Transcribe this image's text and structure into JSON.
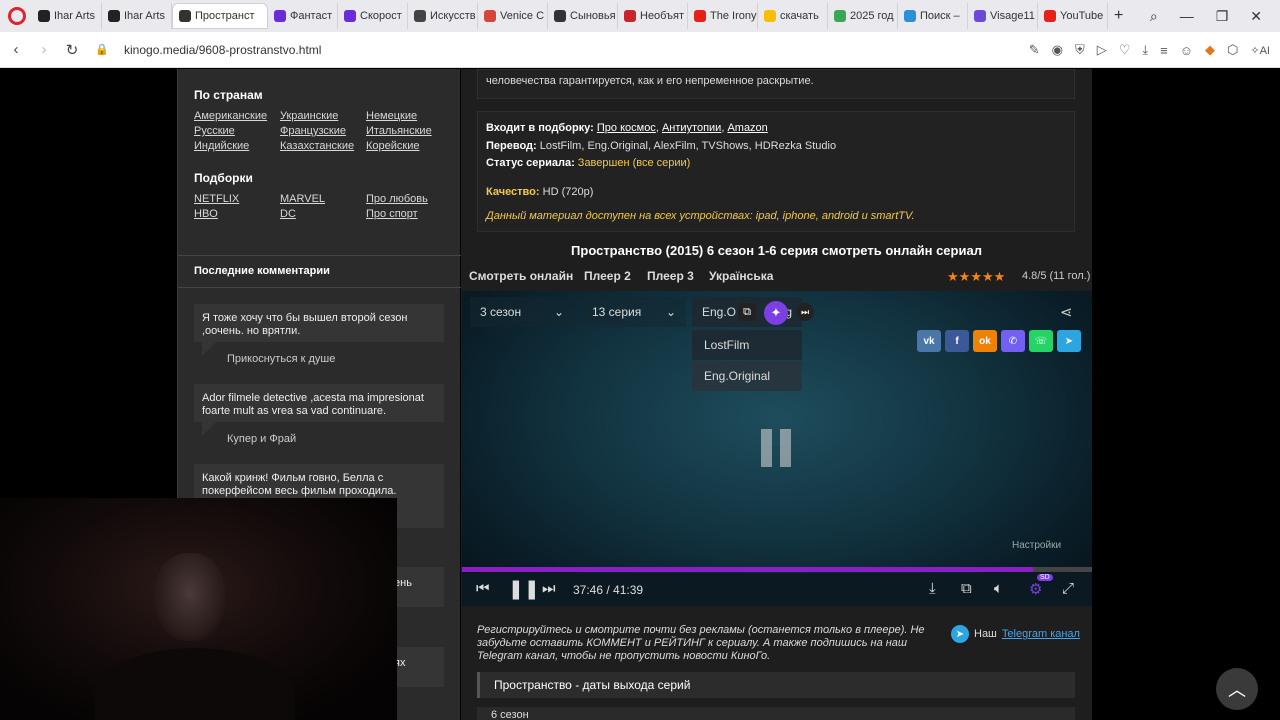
{
  "browser": {
    "tabs": [
      {
        "label": "Ihar Arts",
        "color": "#222"
      },
      {
        "label": "Ihar Arts",
        "color": "#222"
      },
      {
        "label": "Пространст",
        "color": "#333",
        "active": true
      },
      {
        "label": "Фантаст",
        "color": "#6a2bd9"
      },
      {
        "label": "Скорост",
        "color": "#6a2bd9"
      },
      {
        "label": "Искусств",
        "color": "#444"
      },
      {
        "label": "Venice C",
        "color": "#d6453a"
      },
      {
        "label": "Сыновья",
        "color": "#333"
      },
      {
        "label": "Необъят",
        "color": "#c8242b"
      },
      {
        "label": "The Irony",
        "color": "#e62117"
      },
      {
        "label": "скачать",
        "color": "#fbbc05"
      },
      {
        "label": "2025 год",
        "color": "#3aa757"
      },
      {
        "label": "Поиск –",
        "color": "#2d8fd6"
      },
      {
        "label": "Visage11",
        "color": "#6b4bd6"
      },
      {
        "label": "YouTube",
        "color": "#e62117"
      }
    ],
    "new_tab": "+",
    "url": "kinogo.media/9608-prostranstvo.html"
  },
  "sidebar": {
    "countries_heading": "По странам",
    "countries": [
      "Американские",
      "Украинские",
      "Немецкие",
      "Русские",
      "Французские",
      "Итальянские",
      "Индийские",
      "Казахстанские",
      "Корейские"
    ],
    "collections_heading": "Подборки",
    "collections": [
      "NETFLIX",
      "MARVEL",
      "Про любовь",
      "HBO",
      "DC",
      "Про спорт"
    ],
    "comments_heading": "Последние комментарии",
    "comments": [
      {
        "text": "Я тоже хочу что бы вышел второй сезон ,оочень. но врятли.",
        "author": "Прикоснуться к душе"
      },
      {
        "text": "Ador filmele detective ,acesta ma impresionat foarte mult as vrea sa vad continuare.",
        "author": "Купер и Фрай"
      },
      {
        "text": "Какой кринж! Фильм говно, Белла с покерфейсом весь фильм проходила. Бедный",
        "author": ""
      }
    ],
    "partial_1": "ень",
    "partial_2": "ях"
  },
  "main": {
    "top_text": "человечества гарантируется, как и его непременное раскрытие.",
    "collection_label": "Входит в подборку:",
    "collection_links": [
      "Про космос",
      "Антиутопии",
      "Amazon"
    ],
    "translation_label": "Перевод:",
    "translation_value": "LostFilm, Eng.Original, AlexFilm, TVShows, HDRezka Studio",
    "status_label": "Статус сериала:",
    "status_value": "Завершен (все серии)",
    "quality_label": "Качество:",
    "quality_value": "HD (720p)",
    "devices_note": "Данный материал доступен на всех устройствах: ipad, iphone, android и smartTV.",
    "watch_title": "Пространство (2015) 6 сезон 1-6 серия смотреть онлайн сериал",
    "player_tabs": [
      "Смотреть онлайн",
      "Плеер 2",
      "Плеер 3",
      "Українська"
    ],
    "rating_text": "4.8/5 (11 гол.)",
    "rating_stars": 5,
    "player": {
      "season": "3 сезон",
      "episode": "13 серия",
      "voice_selected": "Eng.O",
      "voice_suffix": "g",
      "voice_options": [
        "LostFilm",
        "Eng.Original"
      ],
      "settings_label": "Настройки",
      "time": "37:46 / 41:39",
      "progress": 0.9068,
      "quality_badge": "SD",
      "share_buttons": [
        {
          "label": "vk",
          "color": "#4a76a8"
        },
        {
          "label": "f",
          "color": "#3b5998"
        },
        {
          "label": "ok",
          "color": "#ee8208"
        },
        {
          "label": "✆",
          "color": "#7360f2"
        },
        {
          "label": "☏",
          "color": "#25d366"
        },
        {
          "label": "➤",
          "color": "#2ca5e0"
        }
      ]
    },
    "register_note": "Регистрируйтесь и смотрите почти без рекламы (останется только в плеере). Не забудьте оставить КОММЕНТ и РЕЙТИНГ к сериалу. А также подпишись на наш Telegram канал, чтобы не пропустить новости КиноГо.",
    "telegram_prefix": "Наш",
    "telegram_link": "Telegram канал",
    "dates_heading": "Пространство - даты выхода серий",
    "season_row": "6 сезон"
  }
}
